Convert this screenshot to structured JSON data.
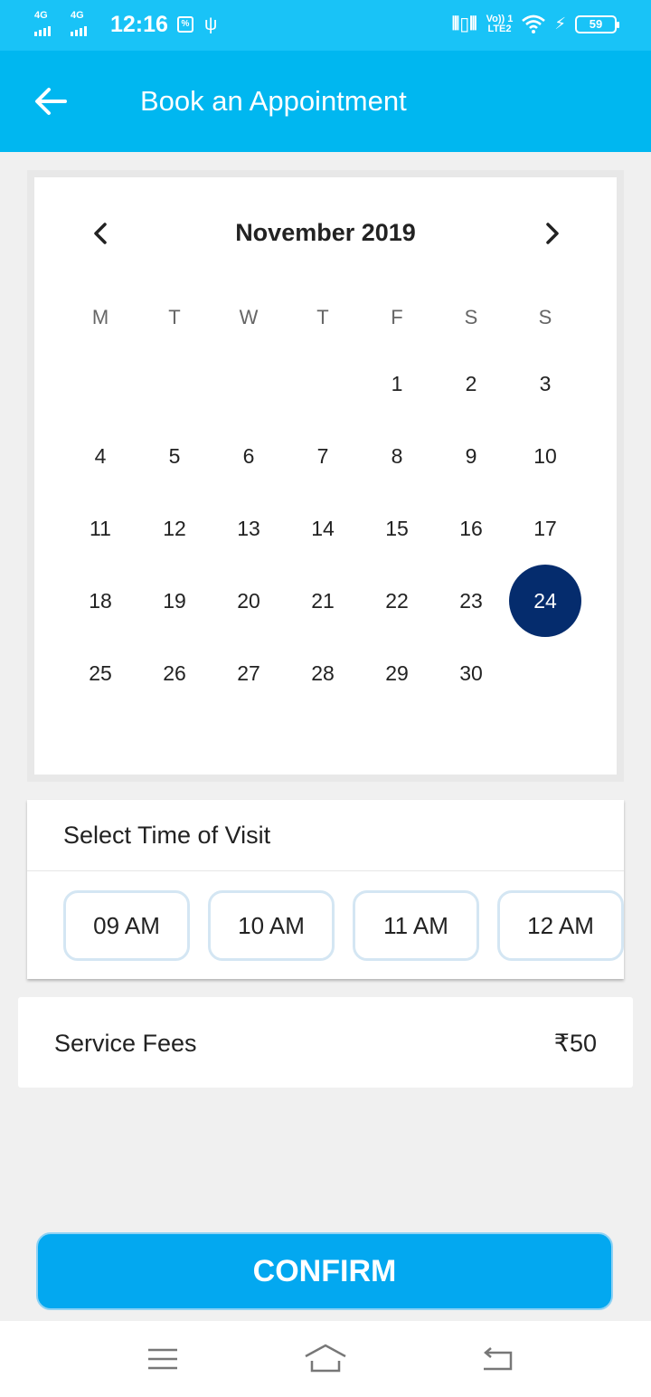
{
  "status_bar": {
    "network1": "4G",
    "network2": "4G",
    "time": "12:16",
    "volte_top": "Vo)) 1",
    "volte_bottom": "LTE2",
    "battery": "59"
  },
  "app_bar": {
    "title": "Book an Appointment"
  },
  "calendar": {
    "month_title": "November 2019",
    "weekdays": [
      "M",
      "T",
      "W",
      "T",
      "F",
      "S",
      "S"
    ],
    "first_weekday_index": 4,
    "days_in_month": 30,
    "selected_day": 24
  },
  "time_of_visit": {
    "title": "Select Time of Visit",
    "slots": [
      "09 AM",
      "10 AM",
      "11 AM",
      "12 AM"
    ]
  },
  "fees": {
    "label": "Service Fees",
    "value": "₹50"
  },
  "confirm": {
    "label": "CONFIRM"
  },
  "colors": {
    "status_bar": "#19c3f7",
    "app_bar": "#00b7f0",
    "selected_day": "#052c6d",
    "confirm_button": "#03a8f0"
  },
  "icons": {
    "back": "arrow-left-icon",
    "prev_month": "chevron-left-icon",
    "next_month": "chevron-right-icon",
    "nav_menu": "menu-icon",
    "nav_home": "home-icon",
    "nav_back": "return-icon"
  }
}
